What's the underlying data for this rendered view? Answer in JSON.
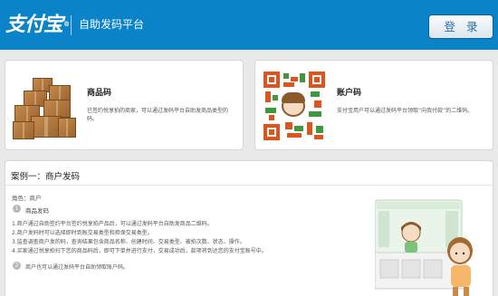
{
  "header": {
    "logo_text": "支付宝",
    "logo_mark": "®",
    "platform_name": "自助发码平台",
    "login_label": "登 录",
    "brand_color": "#0a83c9"
  },
  "cards": {
    "product_code": {
      "title": "商品码",
      "description": "已签约悦享拍的商家，可以通过发码平台自助发商品类型的码。",
      "icon": "boxes-illustration"
    },
    "account_code": {
      "title": "账户码",
      "description": "支付宝用户可以通过发码平台领取“向我付款”的二维码。",
      "icon": "qr-code-illustration"
    }
  },
  "case": {
    "title": "案例一：商户发码",
    "role": "角色：商户",
    "step1": {
      "number": "1",
      "label": "商品发码",
      "lines": [
        "1.商户通过自助签约平台签约悦享拍产品后，可以通过发码平台自助发商品二维码。",
        "2.商户发码时可以选择即时到账交易类型和担保交易类型。",
        "3.监查调查商户发的码，查询结果包含商品名称、创建时间、交易类型、被拍次数、状态、操作。",
        "4.买家通过悦享拍扫下您的商品码后，即可下单并进行支付，交易成功后，款项将到达您的支付宝账号中。"
      ]
    },
    "step2": {
      "number": "2",
      "label": "商户也可以通过发码平台自助领取账户码。"
    },
    "illustration": "shop-counter-illustration"
  }
}
